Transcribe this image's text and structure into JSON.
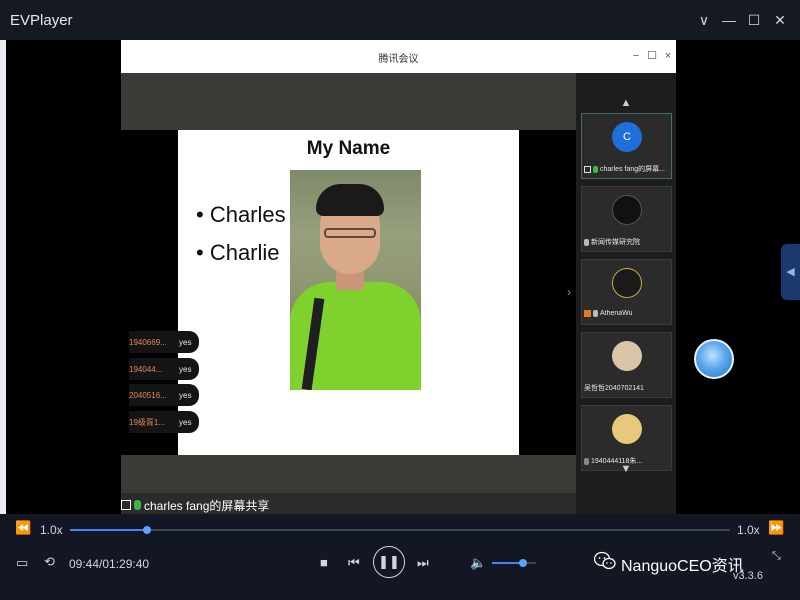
{
  "app": {
    "title": "EVPlayer",
    "window_controls": {
      "collapse": "∨",
      "minimize": "—",
      "maximize": "☐",
      "close": "✕"
    }
  },
  "meeting": {
    "title": "腾讯会议",
    "window_controls": {
      "minimize": "−",
      "maximize": "☐",
      "close": "×"
    },
    "share_label": "charles fang的屏幕共享"
  },
  "slide": {
    "title": "My Name",
    "bullets": [
      "• Charles",
      "• Charlie"
    ]
  },
  "chat": [
    {
      "name": "1940669...",
      "message": "yes"
    },
    {
      "name": "194044...",
      "message": "yes"
    },
    {
      "name": "2040516...",
      "message": "yes"
    },
    {
      "name": "19级胥1...",
      "message": "yes"
    }
  ],
  "participants": [
    {
      "label": "charles fang的屏幕...",
      "avatar": "C",
      "avatar_color": "#1e6fd9",
      "active": true
    },
    {
      "label": "新闻传媒研究院",
      "avatar": "",
      "avatar_color": "#111111",
      "active": false
    },
    {
      "label": "AthenaWu",
      "avatar": "",
      "avatar_color": "#1a1a1a",
      "active": false
    },
    {
      "label": "吴哲哲2040702141",
      "avatar": "",
      "avatar_color": "#d9c6a8",
      "active": false
    },
    {
      "label": "1940444118朱...",
      "avatar": "",
      "avatar_color": "#e6c97a",
      "active": false
    }
  ],
  "player": {
    "speed_left": "1.0x",
    "speed_right": "1.0x",
    "time": "09:44/01:29:40",
    "progress": 0.117,
    "volume": 0.7,
    "watermark": "NanguoCEO资讯",
    "version": "v3.3.6"
  },
  "colors": {
    "accent": "#3f86f4",
    "chat_name": "#e1875a",
    "mic_active": "#39b54a",
    "shirt_green": "#7fd12e"
  }
}
